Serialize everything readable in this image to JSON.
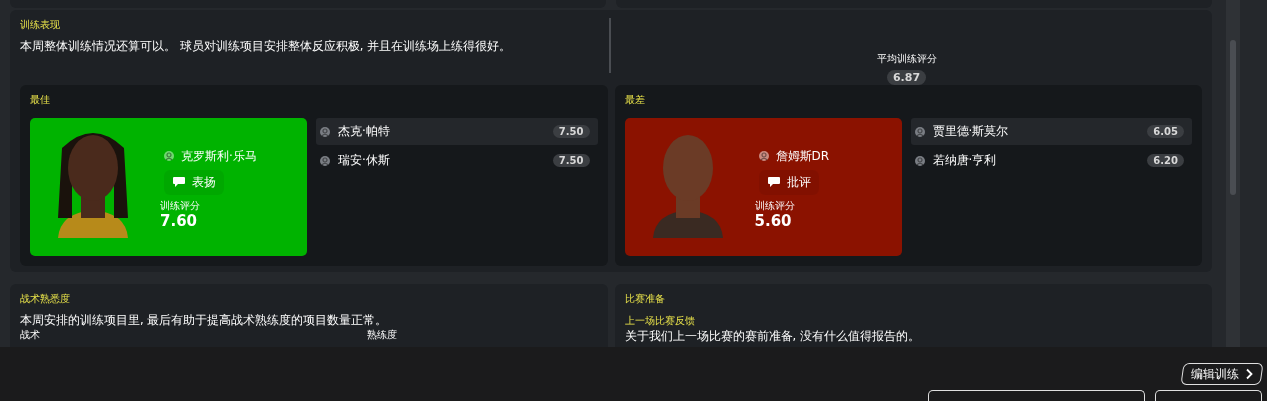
{
  "training": {
    "title": "训练表现",
    "summary": "本周整体训练情况还算可以。 球员对训练项目安排整体反应积极, 并且在训练场上练得很好。",
    "average": {
      "label": "平均训练评分",
      "value": "6.87"
    },
    "groups": [
      {
        "title": "最佳",
        "kind": "best",
        "featured": {
          "name": "克罗斯利·乐马",
          "feedback": "表扬",
          "rating_label": "训练评分",
          "rating": "7.60"
        },
        "others": [
          {
            "name": "杰克·帕特",
            "rating": "7.50",
            "selected": true
          },
          {
            "name": "瑞安·休斯",
            "rating": "7.50",
            "selected": false
          }
        ]
      },
      {
        "title": "最差",
        "kind": "worst",
        "featured": {
          "name": "詹姆斯DR",
          "feedback": "批评",
          "rating_label": "训练评分",
          "rating": "5.60"
        },
        "others": [
          {
            "name": "贾里德·斯莫尔",
            "rating": "6.05",
            "selected": true
          },
          {
            "name": "若纳唐·亨利",
            "rating": "6.20",
            "selected": false
          }
        ]
      }
    ]
  },
  "tactics": {
    "title": "战术熟悉度",
    "summary": "本周安排的训练项目里, 最后有助于提高战术熟练度的项目数量正常。",
    "columns": [
      "战术",
      "熟练度"
    ]
  },
  "match_prep": {
    "title": "比赛准备",
    "subtitle": "上一场比赛反馈",
    "text": "关于我们上一场比赛的赛前准备, 没有什么值得报告的。"
  },
  "footer": {
    "button": "编辑训练"
  }
}
